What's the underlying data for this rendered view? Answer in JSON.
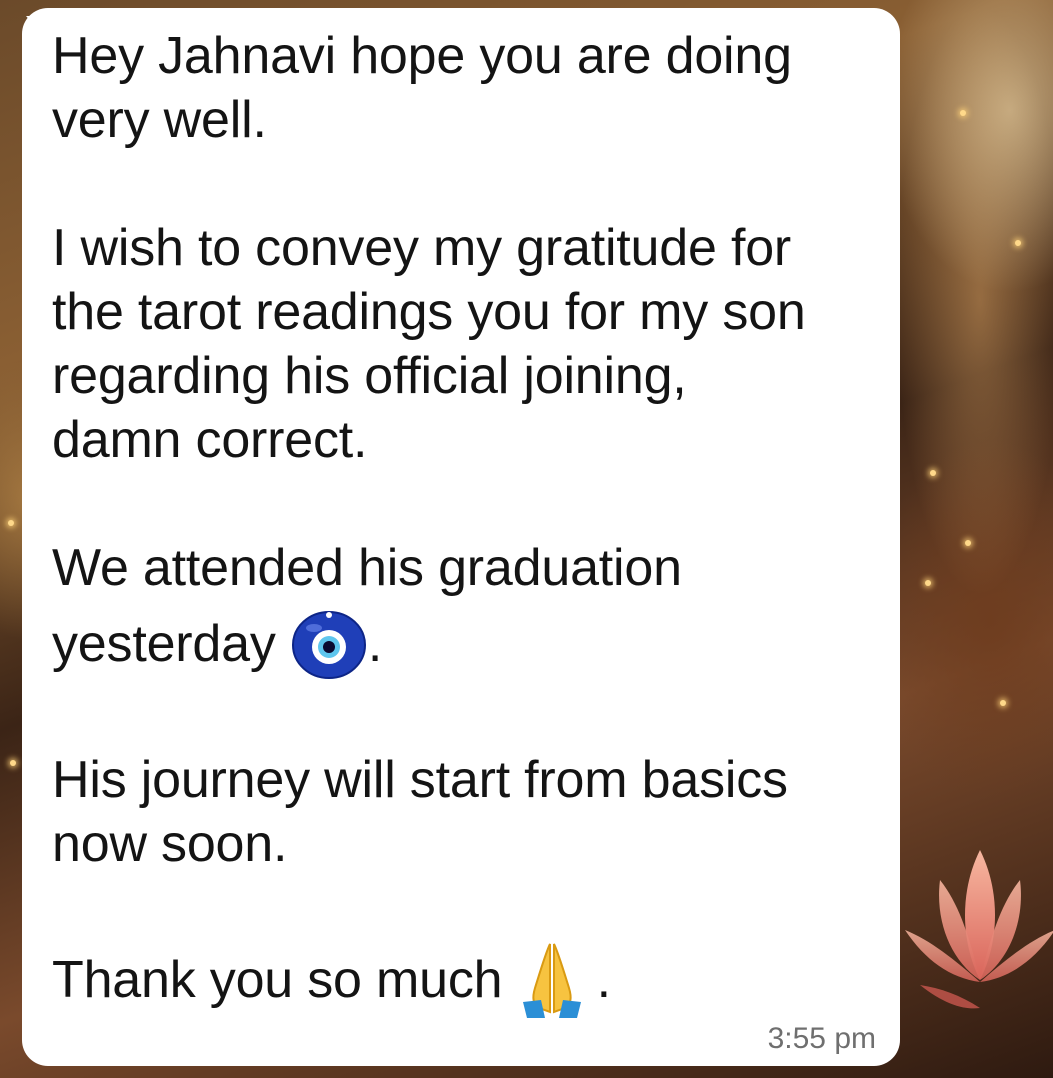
{
  "message": {
    "lines": [
      "Hey Jahnavi hope you are doing",
      "very well.",
      "I wish to convey my gratitude for",
      "the tarot readings you for my son",
      "regarding his official joining,",
      "damn correct.",
      "We attended his graduation",
      "yesterday",
      ".",
      "His journey will start from basics",
      "now soon.",
      "Thank you so much",
      "."
    ],
    "timestamp": "3:55 pm",
    "emojis": {
      "yesterday": "nazar-amulet-icon",
      "thanks": "folded-hands-icon"
    }
  },
  "colors": {
    "bubble": "#ffffff",
    "text": "#141414",
    "timestamp": "#6f6f6f"
  }
}
